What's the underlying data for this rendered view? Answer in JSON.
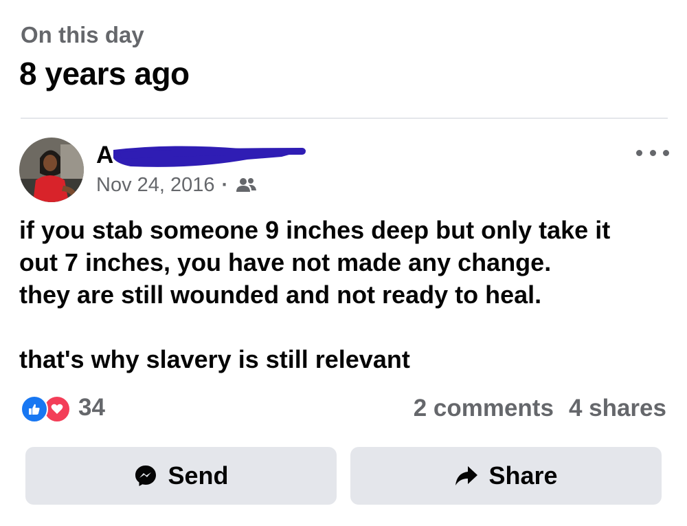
{
  "memory": {
    "subtitle": "On this day",
    "title": "8 years ago"
  },
  "post": {
    "author_visible": "A",
    "date": "Nov 24, 2016",
    "dot": "·",
    "audience_icon": "friends-icon",
    "lines": [
      "if you stab someone 9 inches deep but only take it",
      "out 7 inches, you have not made any change.",
      "they are still wounded and not ready to heal.",
      "",
      "that's why slavery is still relevant"
    ]
  },
  "engagement": {
    "reaction_count": "34",
    "comments": "2 comments",
    "shares": "4 shares"
  },
  "actions": {
    "send_label": "Send",
    "share_label": "Share"
  },
  "colors": {
    "like": "#1877f2",
    "love": "#f33e58",
    "redaction": "#2f1db4",
    "button_bg": "#e4e6eb"
  }
}
